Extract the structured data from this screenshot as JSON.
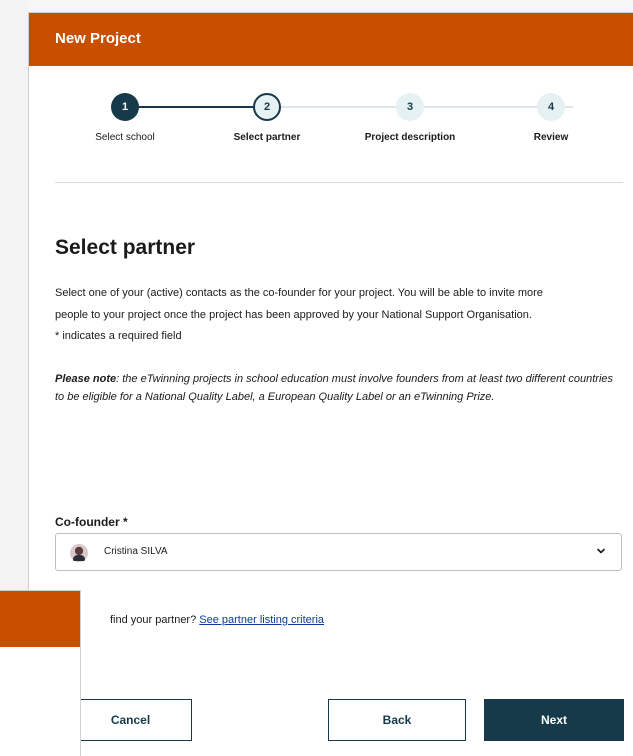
{
  "modal": {
    "title": "New Project"
  },
  "stepper": {
    "steps": [
      {
        "number": "1",
        "label": "Select school",
        "state": "done"
      },
      {
        "number": "2",
        "label": "Select partner",
        "state": "active"
      },
      {
        "number": "3",
        "label": "Project description",
        "state": "todo"
      },
      {
        "number": "4",
        "label": "Review",
        "state": "todo"
      }
    ]
  },
  "content": {
    "title": "Select partner",
    "intro_line1": "Select one of your (active) contacts as the co-founder for your project. You will be able to invite more",
    "intro_line2": "people to your project once the project has been approved by your National Support Organisation.",
    "required_note": "* indicates a required field",
    "note_prefix": "Please note",
    "note_text": ": the eTwinning projects in school education must involve founders from at least two different countries to be eligible for a National Quality Label, a European Quality Label or an eTwinning Prize."
  },
  "cofounder": {
    "label": "Co-founder *",
    "selected": "Cristina SILVA"
  },
  "help": {
    "text": "find your partner? ",
    "link": "See partner listing criteria"
  },
  "buttons": {
    "cancel": "Cancel",
    "back": "Back",
    "next": "Next"
  },
  "colors": {
    "header": "#c84f00",
    "primary": "#163a49",
    "link": "#0a3c92"
  }
}
